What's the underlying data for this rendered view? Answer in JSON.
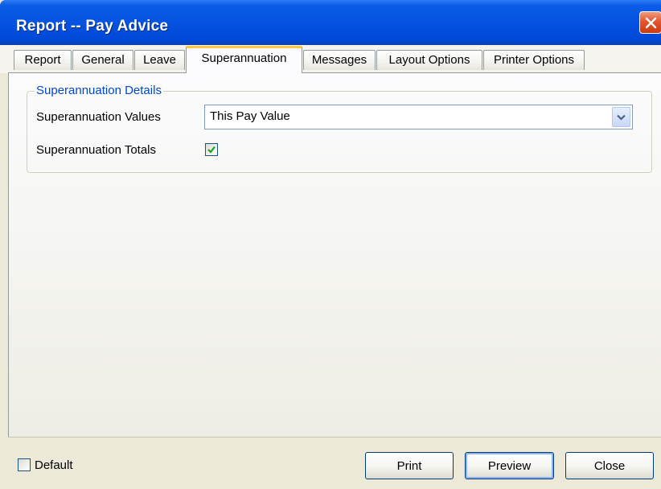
{
  "window": {
    "title": "Report -- Pay Advice",
    "close_icon": "close-icon"
  },
  "tabs": [
    {
      "label": "Report",
      "active": false
    },
    {
      "label": "General",
      "active": false
    },
    {
      "label": "Leave",
      "active": false
    },
    {
      "label": "Superannuation",
      "active": true
    },
    {
      "label": "Messages",
      "active": false
    },
    {
      "label": "Layout Options",
      "active": false
    },
    {
      "label": "Printer Options",
      "active": false
    }
  ],
  "superannuation": {
    "group_title": "Superannuation Details",
    "values_label": "Superannuation Values",
    "values_selected": "This Pay Value",
    "totals_label": "Superannuation Totals",
    "totals_checked": true
  },
  "footer": {
    "default_label": "Default",
    "default_checked": false,
    "print_label": "Print",
    "preview_label": "Preview",
    "close_label": "Close"
  },
  "colors": {
    "titlebar": "#0553e0",
    "group_title": "#0046d5",
    "active_tab_accent": "#ffc83c",
    "check_mark": "#21a121"
  }
}
